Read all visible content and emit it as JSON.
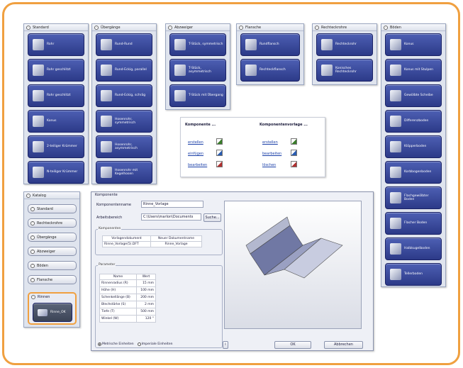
{
  "panels": {
    "standard": {
      "title": "Standard",
      "items": [
        {
          "label": "Rohr"
        },
        {
          "label": "Rohr geschlitzt"
        },
        {
          "label": "Rohr geschlitzt"
        },
        {
          "label": "Konus"
        },
        {
          "label": "2-teiliger Krümmer"
        },
        {
          "label": "N-teiliger Krümmer"
        }
      ]
    },
    "uebergaenge": {
      "title": "Übergänge",
      "items": [
        {
          "label": "Rund-Rund"
        },
        {
          "label": "Rund-Eckig, parallel"
        },
        {
          "label": "Rund-Eckig, schräg"
        },
        {
          "label": "Hosenrohr, symmetrisch"
        },
        {
          "label": "Hosenrohr, asymmetrisch"
        },
        {
          "label": "Hosenrohr mit Kegelhosen"
        }
      ]
    },
    "abzweiger": {
      "title": "Abzweiger",
      "items": [
        {
          "label": "T-Stück, symmetrisch"
        },
        {
          "label": "T-Stück, asymmetrisch"
        },
        {
          "label": "T-Stück mit Übergang"
        }
      ]
    },
    "flansche": {
      "title": "Flansche",
      "items": [
        {
          "label": "Rundflansch"
        },
        {
          "label": "Rechteckflansch"
        }
      ]
    },
    "rechteckrohre": {
      "title": "Rechteckrohre",
      "items": [
        {
          "label": "Rechteckrohr"
        },
        {
          "label": "Konisches Rechteckrohr"
        }
      ]
    },
    "boeden": {
      "title": "Böden",
      "items": [
        {
          "label": "Konus"
        },
        {
          "label": "Konus mit Stulpen"
        },
        {
          "label": "Gewölbte Scheibe"
        },
        {
          "label": "Differenzboden"
        },
        {
          "label": "Klöpperboden"
        },
        {
          "label": "Korbbogenboden"
        },
        {
          "label": "Flachgewölbter Boden"
        },
        {
          "label": "Flacher Boden"
        },
        {
          "label": "Halbkugelboden"
        },
        {
          "label": "Tellerboden"
        }
      ]
    }
  },
  "popup": {
    "komponente_title": "Komponente ...",
    "vorlage_title": "Komponentenvorlage ...",
    "komponente_links": [
      "erstellen",
      "einfügen",
      "bearbeiten"
    ],
    "vorlage_links": [
      "erstellen",
      "bearbeiten",
      "löschen"
    ]
  },
  "katalog": {
    "title": "Katalog",
    "items": [
      "Standard",
      "Rechteckrohre",
      "Übergänge",
      "Abzweiger",
      "Böden",
      "Flansche"
    ],
    "rinnen": {
      "title": "Rinnen",
      "item": "Rinne_OK"
    }
  },
  "dialog": {
    "title": "Komponente",
    "name_label": "Komponentenname",
    "name_value": "Rinne_Vorlage",
    "area_label": "Arbeitsbereich",
    "area_value": "C:\\Users\\marlon\\Documents",
    "browse": "Suche...",
    "components_group": "Komponenten",
    "comp_headers": [
      "Vorlagendokument",
      "Neuer Dokumentname"
    ],
    "comp_row": [
      "Rinne_Vorlage(5).DFT",
      "Rinne_Vorlage"
    ],
    "params_group": "Parameter",
    "param_headers": [
      "Name",
      "Wert"
    ],
    "params": [
      [
        "Rinnenradius (R)",
        "15 mm"
      ],
      [
        "Höhe (H)",
        "100 mm"
      ],
      [
        "Schenkellänge (B)",
        "200 mm"
      ],
      [
        "Blechstärke (S)",
        "2 mm"
      ],
      [
        "Tiefe (T)",
        "500 mm"
      ],
      [
        "Winkel (W)",
        "120 °"
      ]
    ],
    "unit_metric": "Metrische Einheiten",
    "unit_imperial": "Imperiale Einheiten",
    "info": "i",
    "ok": "OK",
    "cancel": "Abbrechen"
  }
}
